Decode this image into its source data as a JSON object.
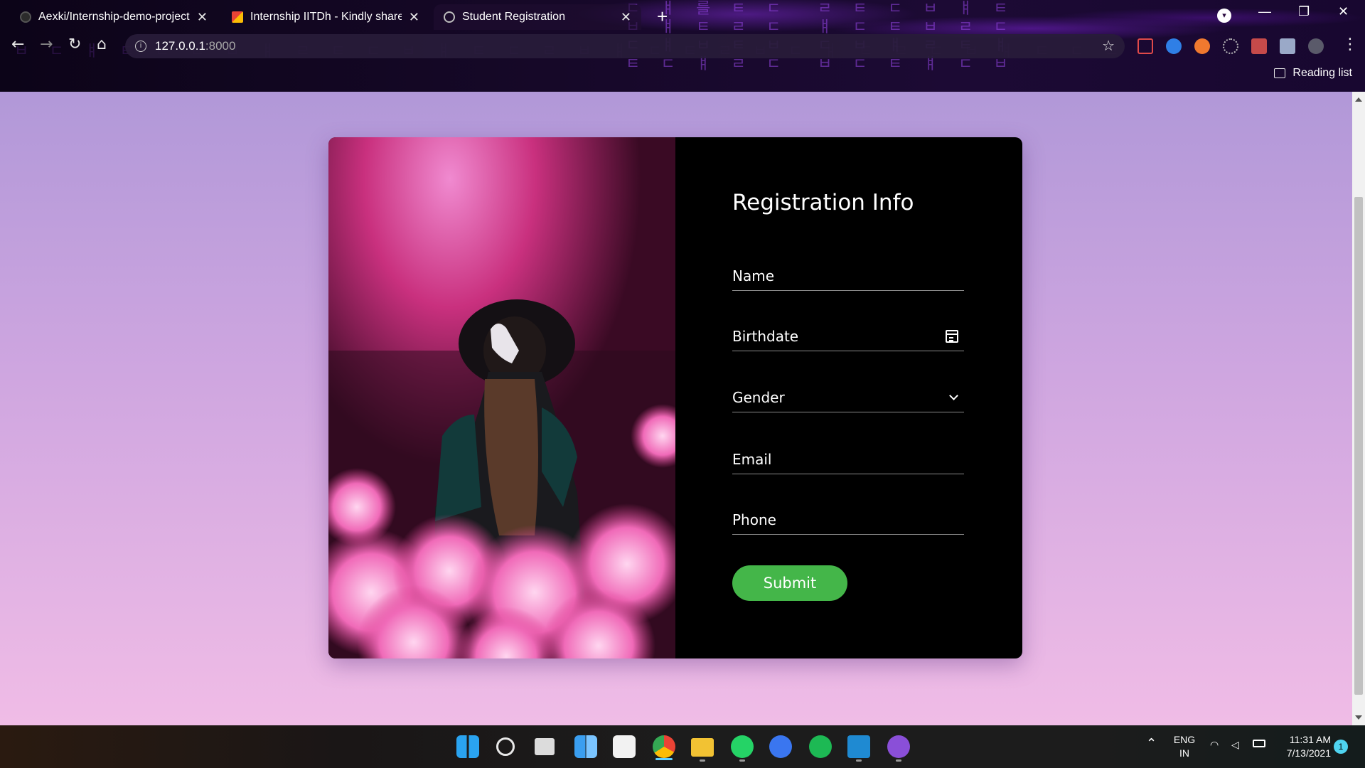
{
  "browser": {
    "tabs": [
      {
        "title": "Aexki/Internship-demo-project",
        "icon": "github-icon",
        "close": "✕"
      },
      {
        "title": "Internship IITDh - Kindly share th",
        "icon": "gmail-icon",
        "close": "✕"
      },
      {
        "title": "Student Registration",
        "icon": "globe-icon",
        "close": "✕"
      }
    ],
    "new_tab": "+",
    "address": {
      "host": "127.0.0.1",
      "port": ":8000"
    },
    "reading_list": "Reading list",
    "window_controls": {
      "minimize": "—",
      "restore": "❐",
      "close": "✕"
    }
  },
  "page": {
    "title": "Registration Info",
    "fields": {
      "name": {
        "placeholder": "Name"
      },
      "birthdate": {
        "placeholder": "Birthdate"
      },
      "gender": {
        "placeholder": "Gender"
      },
      "email": {
        "placeholder": "Email"
      },
      "phone": {
        "placeholder": "Phone"
      }
    },
    "submit_label": "Submit",
    "colors": {
      "submit": "#44b649",
      "panel": "#000000",
      "background_top": "#b198d8",
      "background_bottom": "#f0bce6",
      "smoke": "#e0569a"
    }
  },
  "taskbar": {
    "apps": [
      "windows-start-icon",
      "search-icon",
      "task-view-icon",
      "widgets-icon",
      "store-icon",
      "chrome-icon",
      "file-explorer-icon",
      "whatsapp-icon",
      "signal-icon",
      "spotify-icon",
      "vscode-icon",
      "github-desktop-icon"
    ],
    "language": {
      "line1": "ENG",
      "line2": "IN"
    },
    "time": "11:31 AM",
    "date": "7/13/2021",
    "notifications": "1"
  }
}
